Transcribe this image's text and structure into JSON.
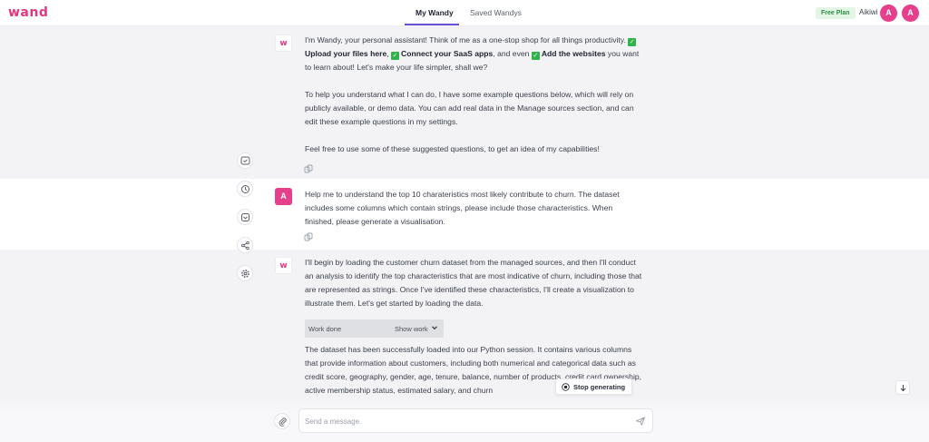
{
  "app": {
    "logo": "wand",
    "tabs": [
      {
        "label": "My Wandy",
        "active": true
      },
      {
        "label": "Saved Wandys",
        "active": false
      }
    ]
  },
  "account": {
    "plan": "Free Plan",
    "name": "Aikiwi",
    "avatar_letter_1": "A",
    "avatar_letter_2": "A"
  },
  "colors": {
    "brand": "#e0377f",
    "avatar": "#e63f8b",
    "tab_underline": "#6b4fd8",
    "check": "#2fb34a",
    "plan_badge": "#e3f6e6"
  },
  "sidebar_icons": [
    "add-chat-icon",
    "history-icon",
    "saved-icon",
    "share-icon",
    "settings-icon"
  ],
  "messages": {
    "intro": {
      "avatar": "w",
      "line1": "I'm Wandy, your personal assistant! Think of me as a one-stop shop for all things productivity.",
      "upload": "Upload your files here",
      "sep1": ",",
      "connect": "Connect your SaaS apps",
      "sep2": ", and even",
      "add": "Add the websites",
      "tail": "you want to learn about! Let's make your life simpler, shall we?",
      "para2": "To help you understand what I can do, I have some example questions below, which will rely on publicly available, or demo data. You can add real data in the Manage sources section, and can edit these example questions in my settings.",
      "para3": "Feel free to use some of these suggested questions, to get an idea of my capabilities!"
    },
    "user": {
      "avatar": "A",
      "text": "Help me to understand the top 10 charateristics most likely contribute to churn. The dataset includes some columns which contain strings, please include those characteristics. When finished, please generate a visualisation."
    },
    "response": {
      "avatar": "w",
      "para1": "I'll begin by loading the customer churn dataset from the managed sources, and then I'll conduct an analysis to identify the top characteristics that are most indicative of churn, including those that are represented as strings. Once I've identified these characteristics, I'll create a visualization to illustrate them. Let's get started by loading the data.",
      "work_done": "Work done",
      "show_work": "Show work",
      "para2": "The dataset has been successfully loaded into our Python session. It contains various columns that provide information about customers, including both numerical and categorical data such as credit score, geography, gender, age, tenure, balance, number of products, credit card ownership, active membership status, estimated salary, and churn"
    }
  },
  "controls": {
    "stop_label": "Stop generating",
    "composer_placeholder": "Send a message."
  }
}
